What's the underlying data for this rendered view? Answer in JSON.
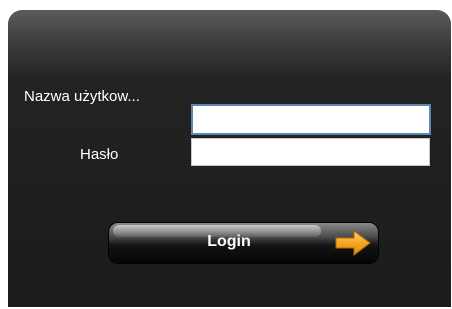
{
  "form": {
    "username_label": "Nazwa użytkow...",
    "password_label": "Hasło",
    "username_value": "",
    "password_value": "",
    "login_label": "Login"
  },
  "icons": {
    "login_arrow": "arrow-right-icon"
  },
  "colors": {
    "panel_background": "#1b1b1b",
    "focus_border": "#5b86b6",
    "arrow": "#f5a623"
  }
}
